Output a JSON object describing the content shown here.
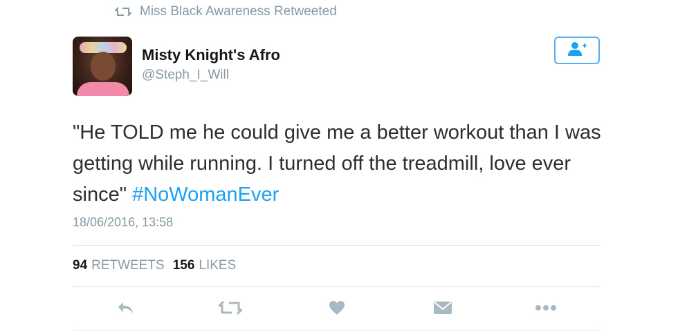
{
  "retweet_context": {
    "icon": "retweet-icon",
    "text": "Miss Black Awareness Retweeted"
  },
  "tweet": {
    "user": {
      "name": "Misty Knight's Afro",
      "handle": "@Steph_I_Will"
    },
    "follow_button": {
      "icon": "add-user-icon"
    },
    "text": "\"He TOLD me he could give me a better workout than I was getting while running. I turned off the treadmill, love ever since\" ",
    "hashtag": "#NoWomanEver",
    "timestamp": "18/06/2016, 13:58",
    "stats": {
      "retweets": {
        "count": "94",
        "label": "RETWEETS"
      },
      "likes": {
        "count": "156",
        "label": "LIKES"
      }
    },
    "actions": [
      "reply-icon",
      "retweet-icon",
      "like-heart-icon",
      "direct-message-icon",
      "more-options-icon"
    ]
  },
  "colors": {
    "accent": "#1da1f2",
    "icon_gray": "#aab8c2",
    "muted_text": "#8899a6",
    "follow_border": "#55acee"
  }
}
